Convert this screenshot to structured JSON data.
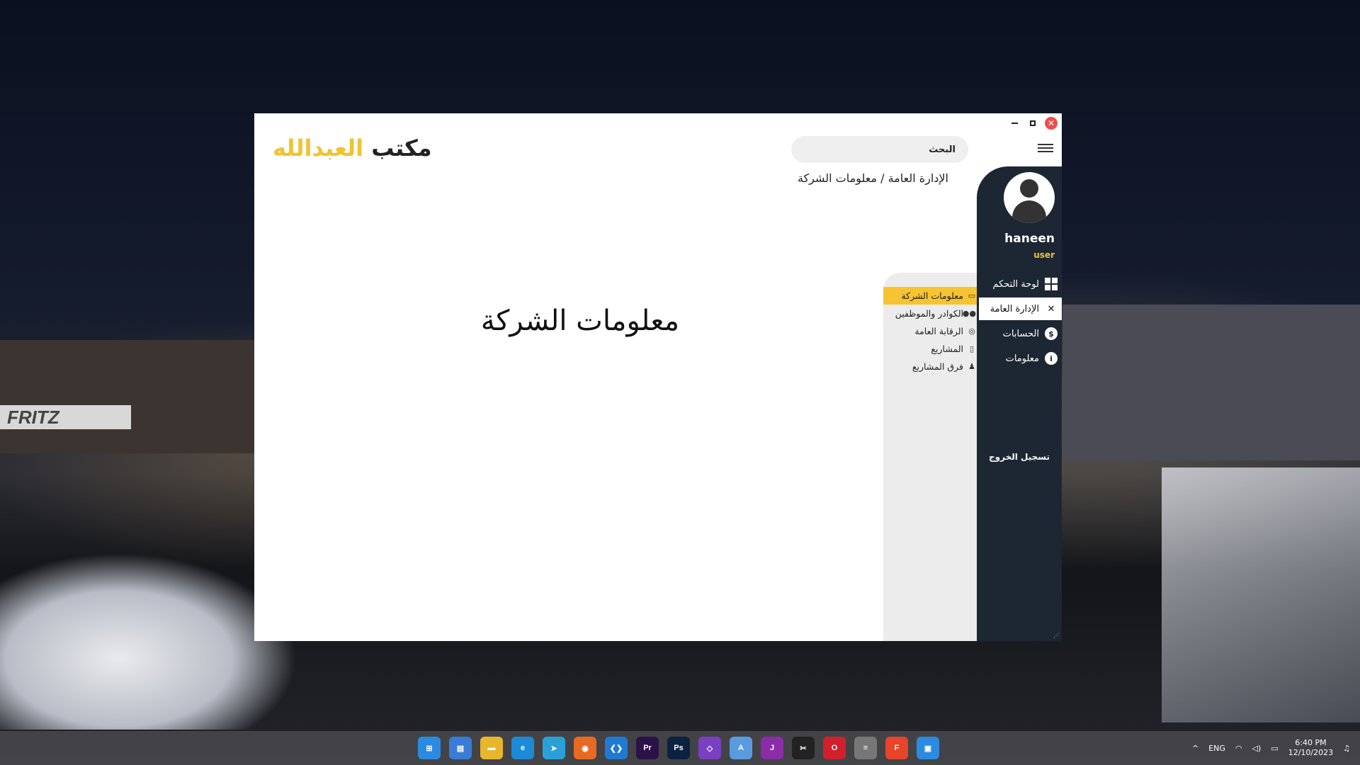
{
  "window": {
    "logo_part1": "مكتب",
    "logo_part2": "العبدالله",
    "search_placeholder": "البحث",
    "breadcrumb": "الإدارة العامة / معلومات الشركة",
    "main_title": "معلومات الشركة",
    "controls": {
      "minimize": "–",
      "maximize": "□",
      "close": "✕"
    }
  },
  "user": {
    "name": "haneen",
    "role": "user"
  },
  "sidebar": {
    "items": [
      {
        "label": "لوحة التحكم",
        "icon": "dashboard-icon"
      },
      {
        "label": "الإدارة العامة",
        "icon": "tools-icon"
      },
      {
        "label": "الحسابات",
        "icon": "dollar-icon"
      },
      {
        "label": "معلومات",
        "icon": "info-icon"
      }
    ],
    "logout": "تسجيل الخروج"
  },
  "submenu": {
    "items": [
      {
        "label": "معلومات الشركة",
        "icon": "briefcase-icon"
      },
      {
        "label": "الكوادر والموظفين",
        "icon": "users-icon"
      },
      {
        "label": "الرقابة العامة",
        "icon": "search-icon"
      },
      {
        "label": "المشاريع",
        "icon": "file-icon"
      },
      {
        "label": "فرق المشاريع",
        "icon": "team-icon"
      }
    ]
  },
  "desktop": {
    "sign": "FRITZ"
  },
  "taskbar": {
    "apps": [
      {
        "name": "windows-start",
        "glyph": "⊞",
        "color": "#2b8be0"
      },
      {
        "name": "store",
        "glyph": "▤",
        "color": "#3a7bd5"
      },
      {
        "name": "file-explorer",
        "glyph": "▬",
        "color": "#e8b62c"
      },
      {
        "name": "edge",
        "glyph": "e",
        "color": "#1d8ad8"
      },
      {
        "name": "telegram",
        "glyph": "➤",
        "color": "#2aa0d8"
      },
      {
        "name": "firefox",
        "glyph": "◉",
        "color": "#e66a22"
      },
      {
        "name": "vscode",
        "glyph": "❮❯",
        "color": "#1f7ad1"
      },
      {
        "name": "premiere",
        "glyph": "Pr",
        "color": "#2a1248"
      },
      {
        "name": "photoshop",
        "glyph": "Ps",
        "color": "#0b2240"
      },
      {
        "name": "visual-studio",
        "glyph": "◇",
        "color": "#7b3fc4"
      },
      {
        "name": "app-store",
        "glyph": "A",
        "color": "#5a9be0"
      },
      {
        "name": "jetbrains",
        "glyph": "J",
        "color": "#8b2ca8"
      },
      {
        "name": "capcut",
        "glyph": "✂",
        "color": "#222222"
      },
      {
        "name": "opera",
        "glyph": "O",
        "color": "#d1202c"
      },
      {
        "name": "database",
        "glyph": "≡",
        "color": "#777777"
      },
      {
        "name": "figma",
        "glyph": "F",
        "color": "#e8442a"
      },
      {
        "name": "app-window",
        "glyph": "▣",
        "color": "#2a8be0"
      }
    ],
    "language": "ENG",
    "time": "6:40 PM",
    "date": "12/10/2023"
  }
}
